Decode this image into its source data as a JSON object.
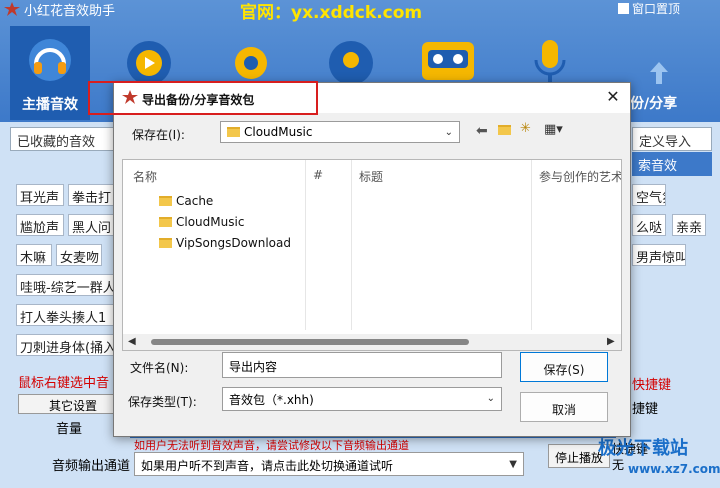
{
  "app": {
    "title": "小红花音效助手",
    "site": "官网：yx.xddck.com",
    "top_check": "窗口置顶",
    "tool_anchor": "主播音效",
    "tool_right": "份/分享",
    "tab_left": "已收藏的音效",
    "right_tab": "定义导入",
    "right_tab2": "索音效",
    "chips_left": [
      "耳光声",
      "拳击打",
      "尴尬声",
      "黑人问",
      "木嘛",
      "女麦吻",
      "哇哦-综艺一群人",
      "打人拳头揍人1",
      "刀刺进身体(捅入"
    ],
    "chips_right": [
      "空气氛",
      "么哒",
      "亲亲",
      "男声惊叫"
    ],
    "hint_left": "鼠标右键选中音",
    "hint_right": "快捷键",
    "other_settings": "其它设置",
    "volume": "音量",
    "output_label": "音频输出通道",
    "output_value": "如果用户听不到声音，请点击此处切换通道试听",
    "behind_hint": "如用户无法听到音效声音，请尝试修改以下音频输出通道",
    "stop_btn": "停止播放",
    "shortcut": "快捷键",
    "shortcut2": "捷键",
    "none": "无",
    "watermark": "极光下载站",
    "watermark2": "www.xz7.com"
  },
  "dialog": {
    "title": "导出备份/分享音效包",
    "save_in_label": "保存在(I):",
    "save_in_value": "CloudMusic",
    "columns": [
      "名称",
      "#",
      "标题",
      "参与创作的艺术"
    ],
    "files": [
      "Cache",
      "CloudMusic",
      "VipSongsDownload"
    ],
    "filename_label": "文件名(N):",
    "filename_value": "导出内容",
    "filetype_label": "保存类型(T):",
    "filetype_value": "音效包（*.xhh)",
    "save_button": "保存(S)",
    "cancel_button": "取消"
  },
  "colors": {
    "accent": "#2f6fc2",
    "highlight_box": "#d81e1e",
    "site": "#ffe400"
  }
}
